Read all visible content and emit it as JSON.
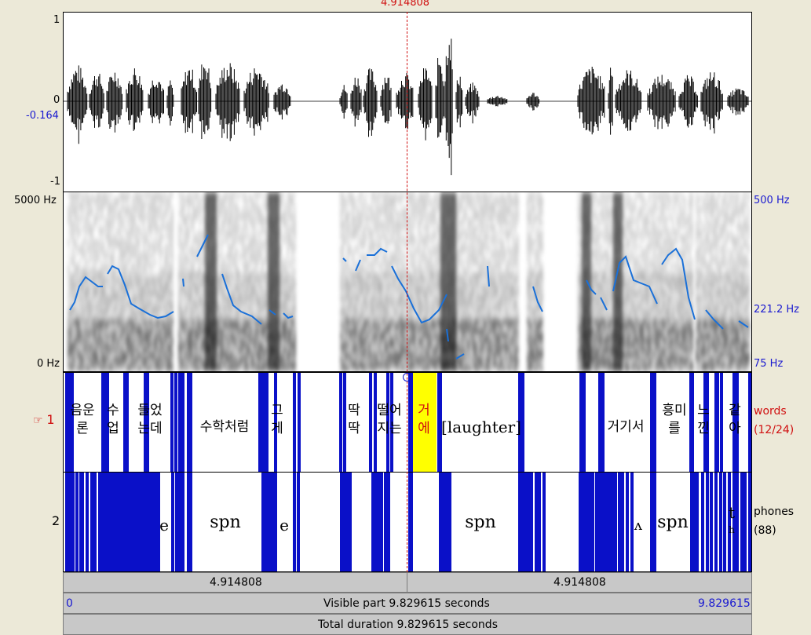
{
  "cursor_time": "4.914808",
  "waveform": {
    "ymax_label": "1",
    "zero_label": "0",
    "cursor_value_label": "-0.164",
    "ymin_label": "-1"
  },
  "spectrogram": {
    "freq_max_label": "5000 Hz",
    "freq_min_label": "0 Hz",
    "pitch_max_label": "500 Hz",
    "pitch_cursor_label": "221.2 Hz",
    "pitch_min_label": "75 Hz"
  },
  "tiers": [
    {
      "number": "1",
      "name": "words",
      "count": "(12/24)",
      "selected": true
    },
    {
      "number": "2",
      "name": "phones",
      "count": "(88)",
      "selected": false
    }
  ],
  "words": [
    {
      "text": "음운\n론"
    },
    {
      "text": "수\n업"
    },
    {
      "text": "들었\n는데"
    },
    {
      "text": "수학처럼"
    },
    {
      "text": "그\n게"
    },
    {
      "text": "딱\n딱"
    },
    {
      "text": "떨어\n지는"
    },
    {
      "text": "거\n에"
    },
    {
      "text": "[laughter]"
    },
    {
      "text": "거기서"
    },
    {
      "text": "흥미\n를"
    },
    {
      "text": "느\n낀"
    },
    {
      "text": "같\n아"
    }
  ],
  "phones": [
    {
      "text": "e"
    },
    {
      "text": "spn"
    },
    {
      "text": "e"
    },
    {
      "text": "spn"
    },
    {
      "text": "ʌ"
    },
    {
      "text": "spn"
    },
    {
      "text": "t"
    },
    {
      "text": "h"
    }
  ],
  "navigation": {
    "left_segment": "4.914808",
    "right_segment": "4.914808",
    "visible_start": "0",
    "visible_label": "Visible part 9.829615 seconds",
    "visible_end": "9.829615",
    "total_label": "Total duration 9.829615 seconds"
  },
  "colors": {
    "boundary": "#0a10c8",
    "selected_interval": "#ffff00",
    "pitch": "#1a70d8",
    "cursor": "#d01010"
  }
}
